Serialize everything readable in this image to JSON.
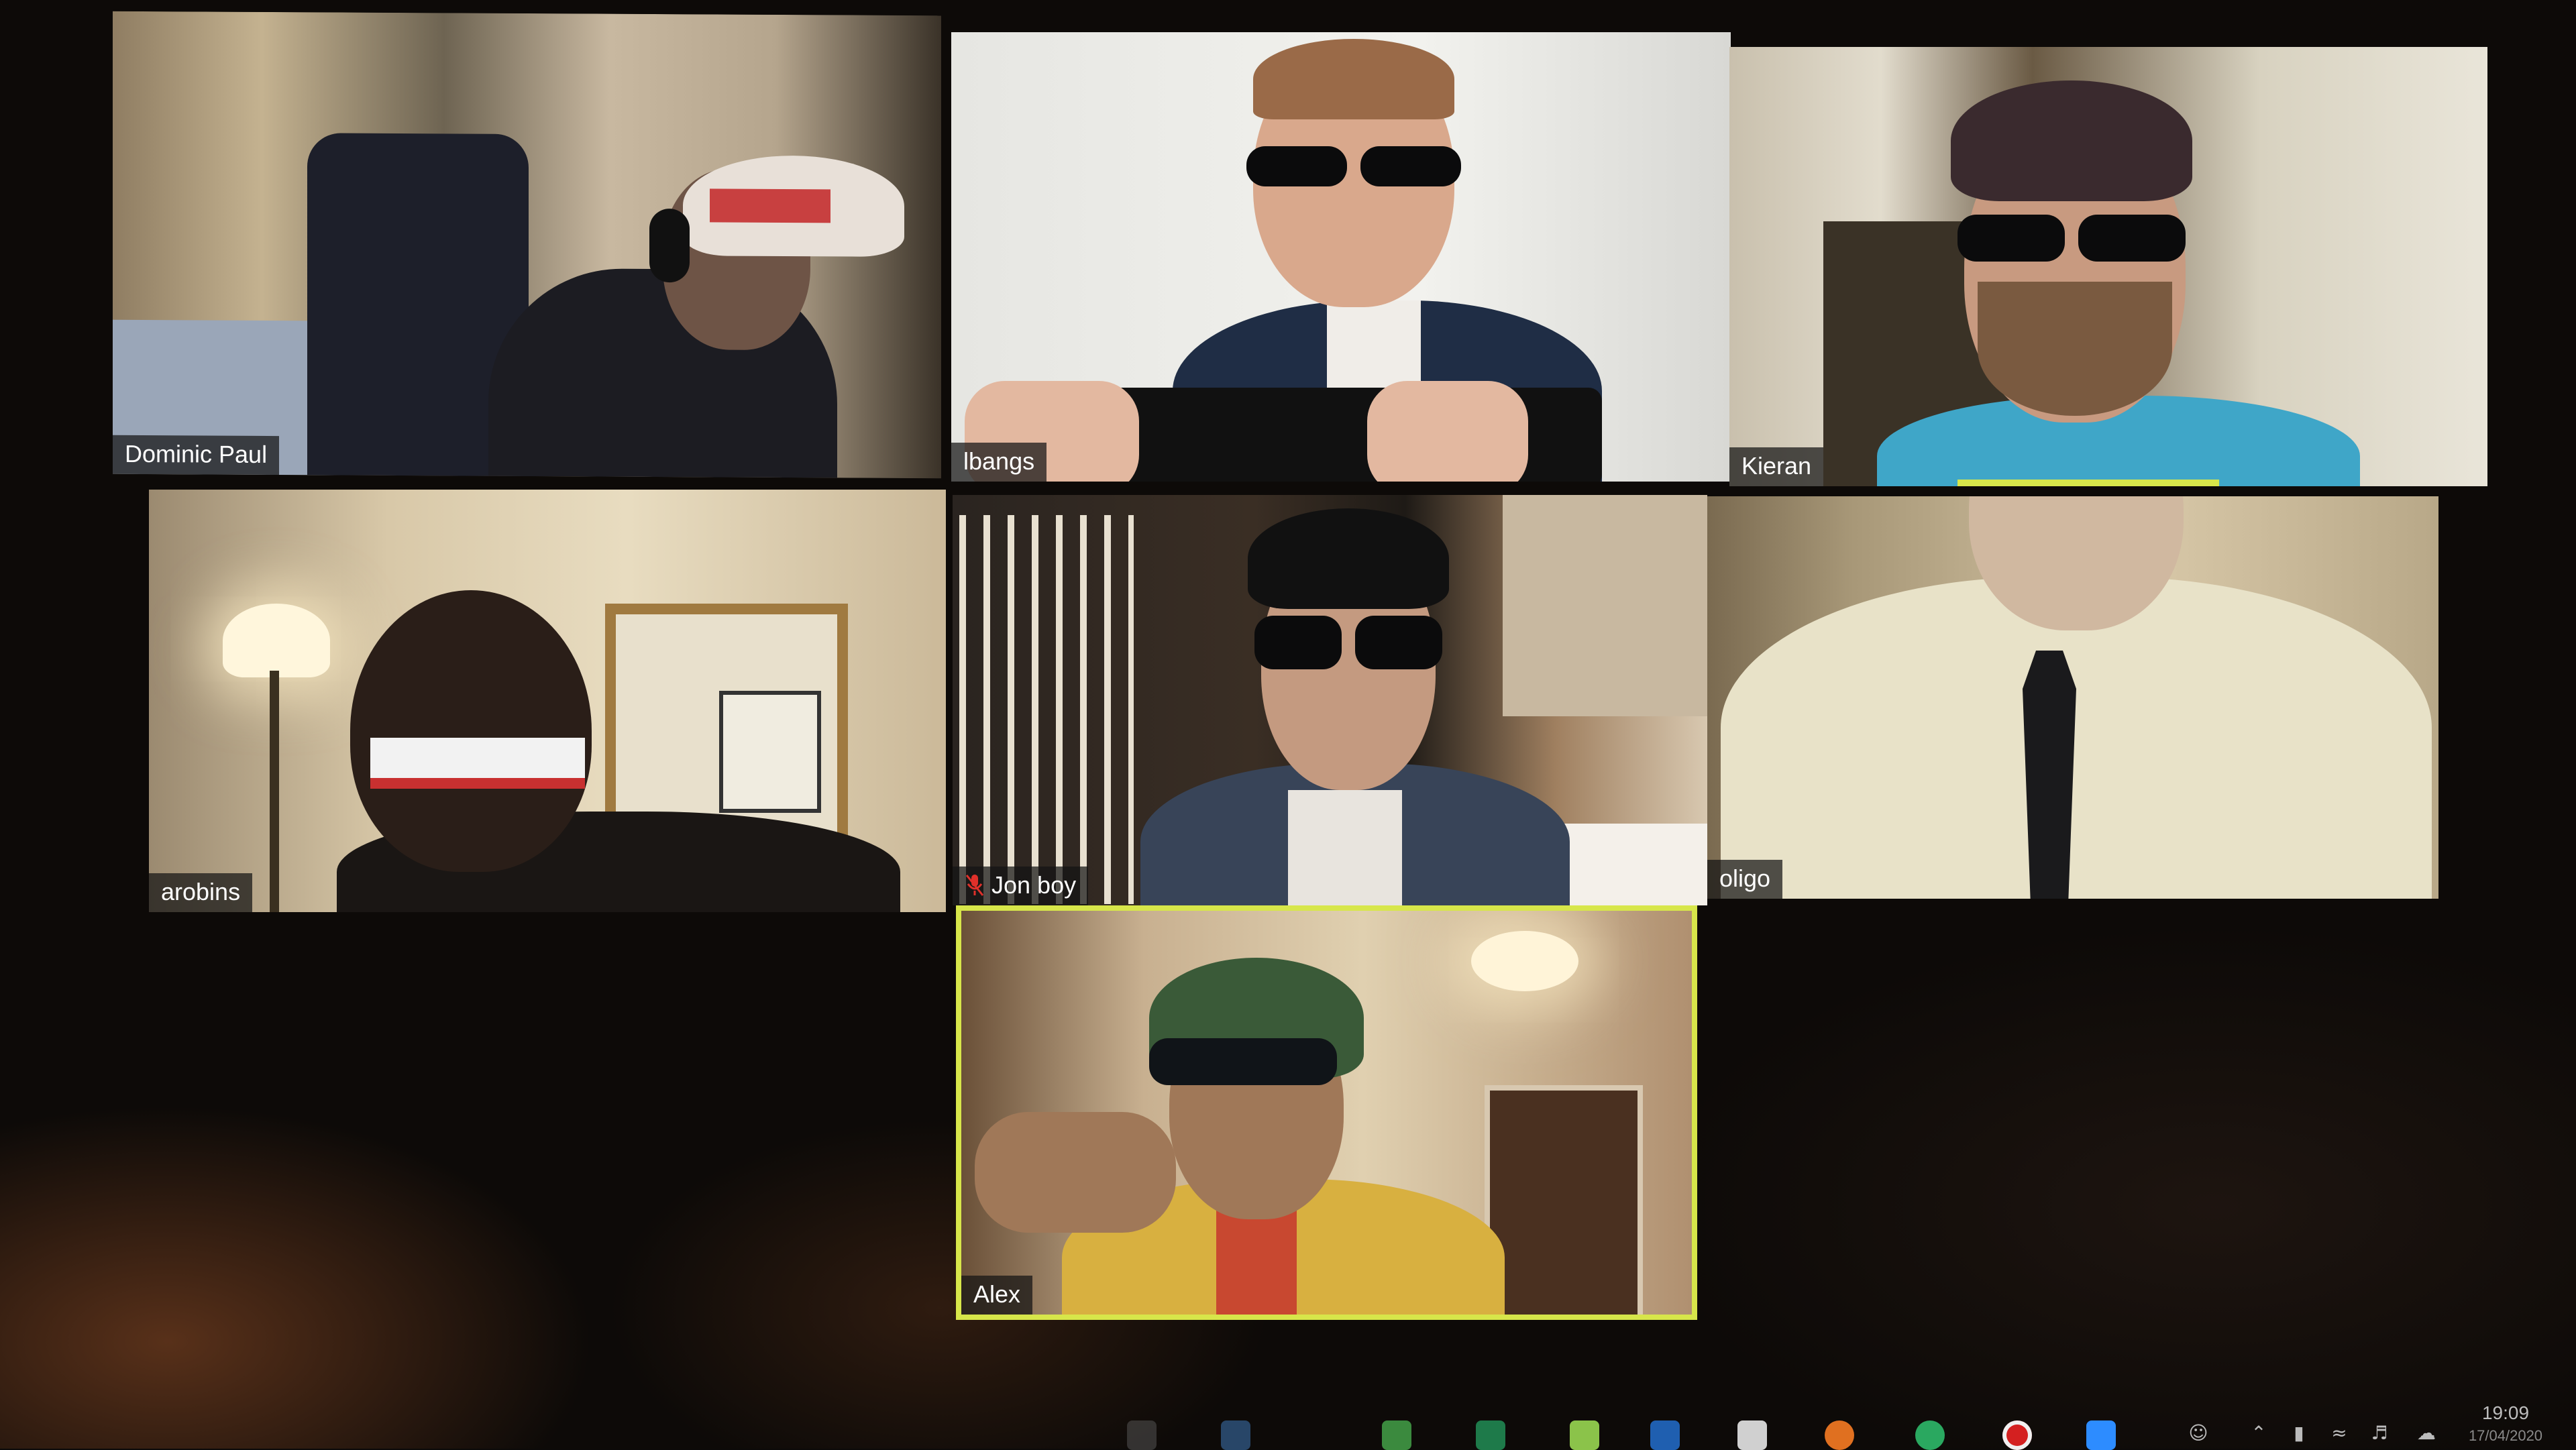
{
  "participants": [
    {
      "name": "Dominic Paul",
      "muted": false
    },
    {
      "name": "lbangs",
      "muted": false
    },
    {
      "name": "Kieran",
      "muted": false,
      "speaking": true
    },
    {
      "name": "arobins",
      "muted": false
    },
    {
      "name": "Jon boy",
      "muted": true
    },
    {
      "name": "oligo",
      "muted": false
    },
    {
      "name": "Alex",
      "muted": false,
      "active_speaker": true
    }
  ],
  "colors": {
    "active_speaker_border": "#d7e64a",
    "name_tag_bg": "#141414",
    "mic_muted": "#e0302a"
  },
  "taskbar": {
    "clock_time": "19:09",
    "clock_date": "17/04/2020"
  }
}
